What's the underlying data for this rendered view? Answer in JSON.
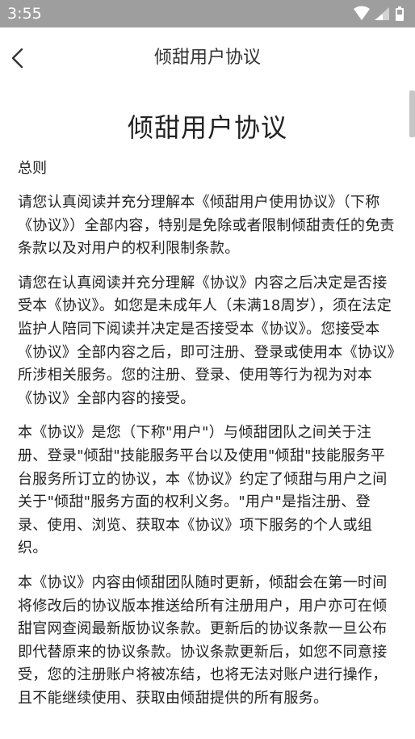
{
  "status_bar": {
    "time": "3:55",
    "icons": [
      "wifi-icon",
      "signal-icon",
      "battery-icon"
    ]
  },
  "app_bar": {
    "title": "倾甜用户协议",
    "back_icon": "chevron-left-icon"
  },
  "document": {
    "title": "倾甜用户协议",
    "section_heading": "总则",
    "paragraphs": [
      "请您认真阅读并充分理解本《倾甜用户使用协议》（下称《协议》）全部内容，特别是免除或者限制倾甜责任的免责条款以及对用户的权利限制条款。",
      "请您在认真阅读并充分理解《协议》内容之后决定是否接受本《协议》。如您是未成年人（未满18周岁），须在法定监护人陪同下阅读并决定是否接受本《协议》。您接受本《协议》全部内容之后，即可注册、登录或使用本《协议》所涉相关服务。您的注册、登录、使用等行为视为对本《协议》全部内容的接受。",
      "本《协议》是您（下称\"用户\"）与倾甜团队之间关于注册、登录\"倾甜\"技能服务平台以及使用\"倾甜\"技能服务平台服务所订立的协议，本《协议》约定了倾甜与用户之间关于\"倾甜\"服务方面的权利义务。\"用户\"是指注册、登录、使用、浏览、获取本《协议》项下服务的个人或组织。",
      "本《协议》内容由倾甜团队随时更新，倾甜会在第一时间将修改后的协议版本推送给所有注册用户，用户亦可在倾甜官网查阅最新版协议条款。更新后的协议条款一旦公布即代替原来的协议条款。协议条款更新后，如您不同意接受，您的注册账户将被冻结，也将无法对账户进行操作，且不能继续使用、获取由倾甜提供的所有服务。"
    ]
  },
  "colors": {
    "status_bar_bg": "#9e9e9e",
    "text": "#222222",
    "background": "#ffffff"
  }
}
